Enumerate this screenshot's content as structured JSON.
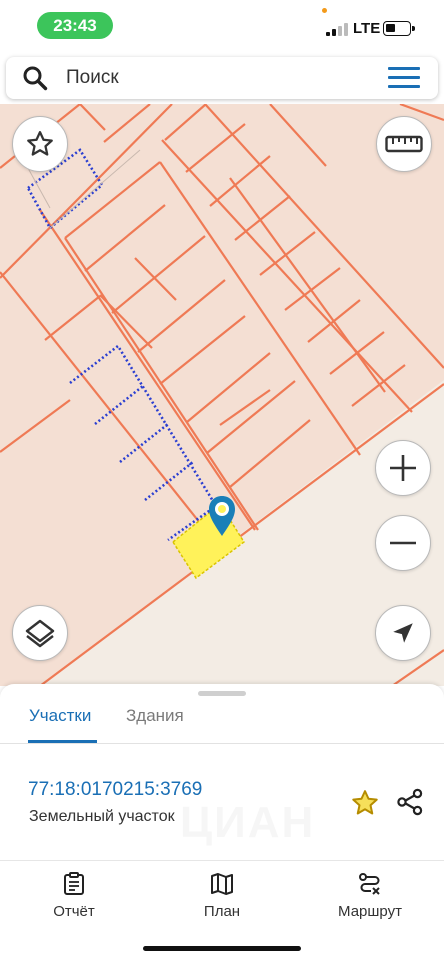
{
  "status_bar": {
    "time": "23:43",
    "network": "LTE"
  },
  "search": {
    "placeholder": "Поиск",
    "icon": "search-icon",
    "menu_icon": "hamburger-menu-icon"
  },
  "map": {
    "controls": {
      "favorite": "star-outline-icon",
      "ruler": "ruler-icon",
      "zoom_in": "plus-icon",
      "zoom_out": "minus-icon",
      "layers": "layers-icon",
      "locate": "navigation-arrow-icon"
    },
    "marker": "location-pin-icon",
    "colors": {
      "background": "#f4dfd3",
      "road": "#f3ece4",
      "parcel_border": "#ef7a55",
      "selected_parcel": "#fff25a",
      "dotted_boundary": "#2b3fd1",
      "marker": "#1a7fb8"
    }
  },
  "sheet": {
    "tabs": [
      {
        "label": "Участки",
        "active": true
      },
      {
        "label": "Здания",
        "active": false
      }
    ],
    "result": {
      "cadastral_number": "77:18:0170215:3769",
      "type": "Земельный участок"
    },
    "actions": {
      "favorite": "star-icon",
      "share": "share-icon"
    },
    "colors": {
      "accent": "#1a6fb5",
      "star": "#e0b40b"
    }
  },
  "bottom_nav": {
    "items": [
      {
        "label": "Отчёт",
        "icon": "report-clipboard-icon"
      },
      {
        "label": "План",
        "icon": "map-plan-icon"
      },
      {
        "label": "Маршрут",
        "icon": "route-icon"
      }
    ]
  }
}
